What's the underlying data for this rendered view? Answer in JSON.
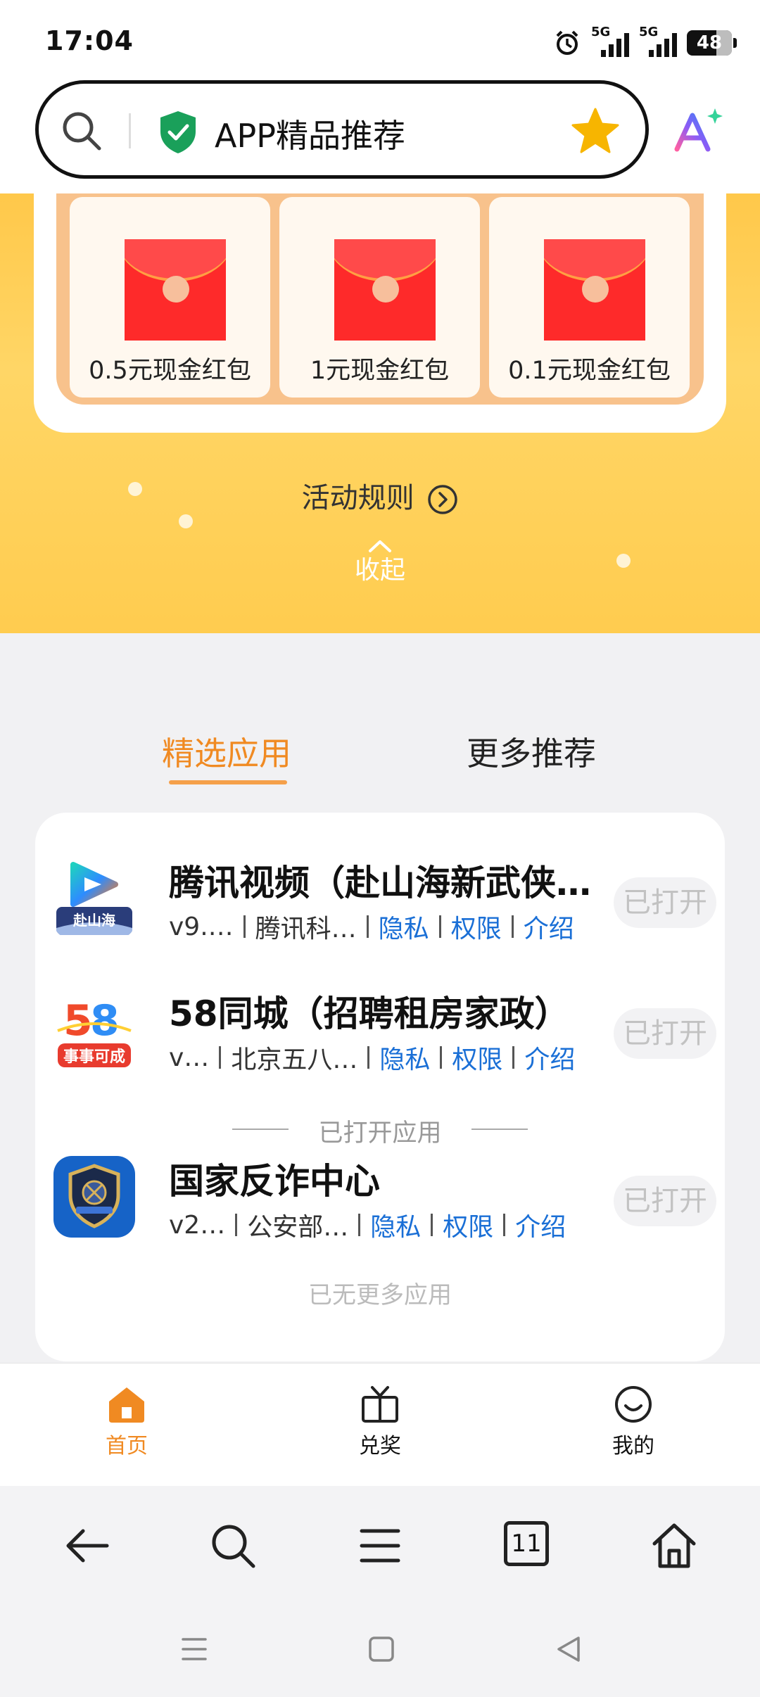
{
  "status_bar": {
    "time": "17:04",
    "signal_1_label": "5G",
    "signal_2_label": "5G",
    "battery_level": "48",
    "icons": [
      "alarm-icon",
      "signal-icon",
      "battery-icon"
    ]
  },
  "search": {
    "query": "APP精品推荐",
    "icons": [
      "search-icon",
      "shield-check-icon",
      "star-icon",
      "ai-assistant-icon"
    ]
  },
  "activity": {
    "red_packets": [
      {
        "label": "0.5元现金红包"
      },
      {
        "label": "1元现金红包"
      },
      {
        "label": "0.1元现金红包"
      }
    ],
    "rules_label": "活动规则",
    "collapse_label": "收起"
  },
  "tabs": [
    {
      "label": "精选应用",
      "active": true
    },
    {
      "label": "更多推荐",
      "active": false
    }
  ],
  "apps": [
    {
      "name": "腾讯视频（赴山海新武侠…",
      "version": "v9.…",
      "developer": "腾讯科…",
      "privacy": "隐私",
      "permissions": "权限",
      "intro": "介绍",
      "action": "已打开"
    },
    {
      "name": "58同城（招聘租房家政）",
      "version": "v…",
      "developer": "北京五八…",
      "privacy": "隐私",
      "permissions": "权限",
      "intro": "介绍",
      "action": "已打开"
    },
    {
      "name": "国家反诈中心",
      "version": "v2…",
      "developer": "公安部…",
      "privacy": "隐私",
      "permissions": "权限",
      "intro": "介绍",
      "action": "已打开"
    }
  ],
  "opened_divider": "已打开应用",
  "no_more": "已无更多应用",
  "bottom_nav": [
    {
      "label": "首页",
      "icon": "home-icon",
      "active": true
    },
    {
      "label": "兑奖",
      "icon": "gift-tv-icon",
      "active": false
    },
    {
      "label": "我的",
      "icon": "smiley-icon",
      "active": false
    }
  ],
  "browser_toolbar": {
    "tab_count": "11",
    "icons": [
      "back-icon",
      "search-icon",
      "menu-icon",
      "tabs-icon",
      "home-icon"
    ]
  },
  "colors": {
    "accent": "#f08a22",
    "link": "#1a6fd6",
    "banner": "#ffd666"
  }
}
